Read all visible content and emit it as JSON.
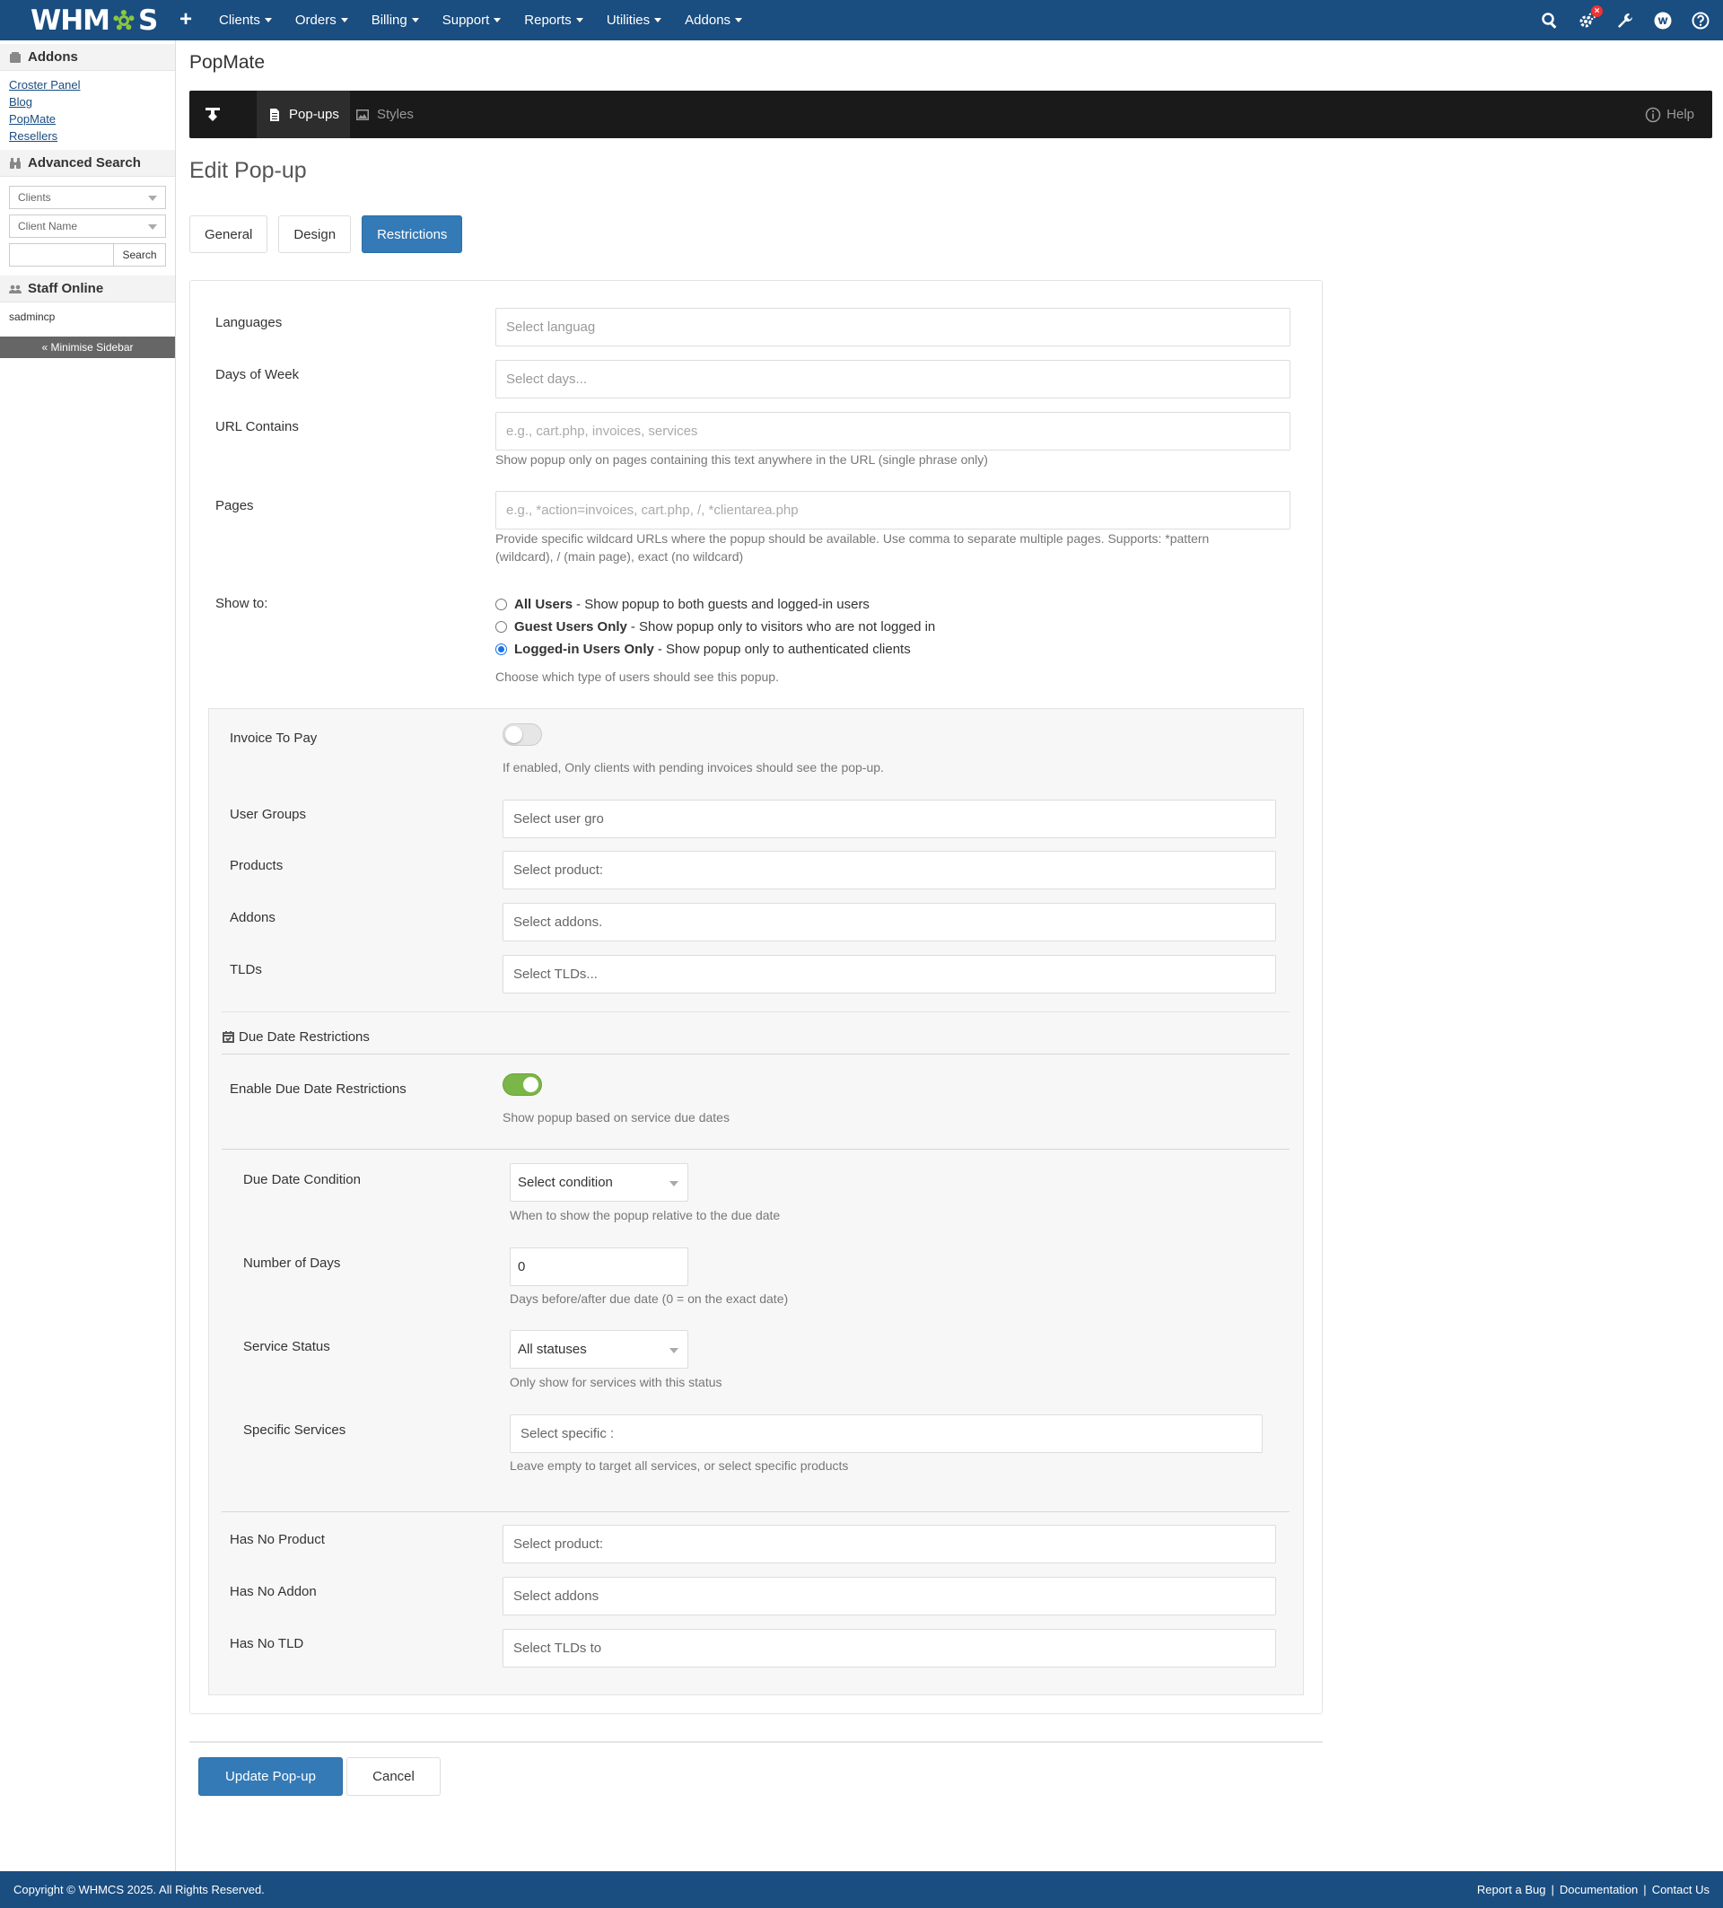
{
  "nav": {
    "logo": "WHMCS",
    "logo_left": "WHM",
    "logo_right": "S",
    "items": [
      "Clients",
      "Orders",
      "Billing",
      "Support",
      "Reports",
      "Utilities",
      "Addons"
    ]
  },
  "sidebar": {
    "addons_title": "Addons",
    "addon_links": [
      "Croster Panel",
      "Blog",
      "PopMate",
      "Resellers"
    ],
    "adv_search_title": "Advanced Search",
    "search_type": "Clients",
    "search_field": "Client Name",
    "search_button": "Search",
    "staff_title": "Staff Online",
    "staff_name": "sadmincp",
    "minimise": "« Minimise Sidebar"
  },
  "page": {
    "title": "PopMate",
    "tab_popups": "Pop-ups",
    "tab_styles": "Styles",
    "help": "Help",
    "edit_title": "Edit Pop-up",
    "tabs": [
      "General",
      "Design",
      "Restrictions"
    ]
  },
  "form": {
    "languages_label": "Languages",
    "languages_ph": "Select languag",
    "days_label": "Days of Week",
    "days_ph": "Select days...",
    "url_label": "URL Contains",
    "url_ph": "e.g., cart.php, invoices, services",
    "url_help": "Show popup only on pages containing this text anywhere in the URL (single phrase only)",
    "pages_label": "Pages",
    "pages_ph": "e.g., *action=invoices, cart.php, /, *clientarea.php",
    "pages_help_1": "Provide specific wildcard URLs where the popup should be available. Use comma to separate multiple pages. Supports: *pattern",
    "pages_help_2": "(wildcard), / (main page), exact (no wildcard)",
    "show_label": "Show to:",
    "show_options": [
      {
        "title": "All Users",
        "desc": "- Show popup to both guests and logged-in users"
      },
      {
        "title": "Guest Users Only",
        "desc": "- Show popup only to visitors who are not logged in"
      },
      {
        "title": "Logged-in Users Only",
        "desc": "- Show popup only to authenticated clients"
      }
    ],
    "show_help": "Choose which type of users should see this popup.",
    "invoice_label": "Invoice To Pay",
    "invoice_help": "If enabled, Only clients with pending invoices should see the pop-up.",
    "groups_label": "User Groups",
    "groups_ph": "Select user gro",
    "products_label": "Products",
    "products_ph": "Select product:",
    "addons_label": "Addons",
    "addons_ph": "Select addons.",
    "tlds_label": "TLDs",
    "tlds_ph": "Select TLDs...",
    "due_section": "Due Date Restrictions",
    "due_enable_label": "Enable Due Date Restrictions",
    "due_enable_help": "Show popup based on service due dates",
    "condition_label": "Due Date Condition",
    "condition_value": "Select condition",
    "condition_help": "When to show the popup relative to the due date",
    "days_num_label": "Number of Days",
    "days_num_value": "0",
    "days_num_help": "Days before/after due date (0 = on the exact date)",
    "status_label": "Service Status",
    "status_value": "All statuses",
    "status_help": "Only show for services with this status",
    "services_label": "Specific Services",
    "services_ph": "Select specific :",
    "services_help": "Leave empty to target all services, or select specific products",
    "noprod_label": "Has No Product",
    "noprod_ph": "Select product:",
    "noaddon_label": "Has No Addon",
    "noaddon_ph": "Select addons",
    "notld_label": "Has No TLD",
    "notld_ph": "Select TLDs to"
  },
  "actions": {
    "update": "Update Pop-up",
    "cancel": "Cancel"
  },
  "footer": {
    "copyright": "Copyright © WHMCS 2025. All Rights Reserved.",
    "links": [
      "Report a Bug",
      "Documentation",
      "Contact Us"
    ]
  },
  "colors": {
    "nav": "#1a4d80",
    "primary": "#337ab7",
    "toggle_on": "#7ab648"
  }
}
